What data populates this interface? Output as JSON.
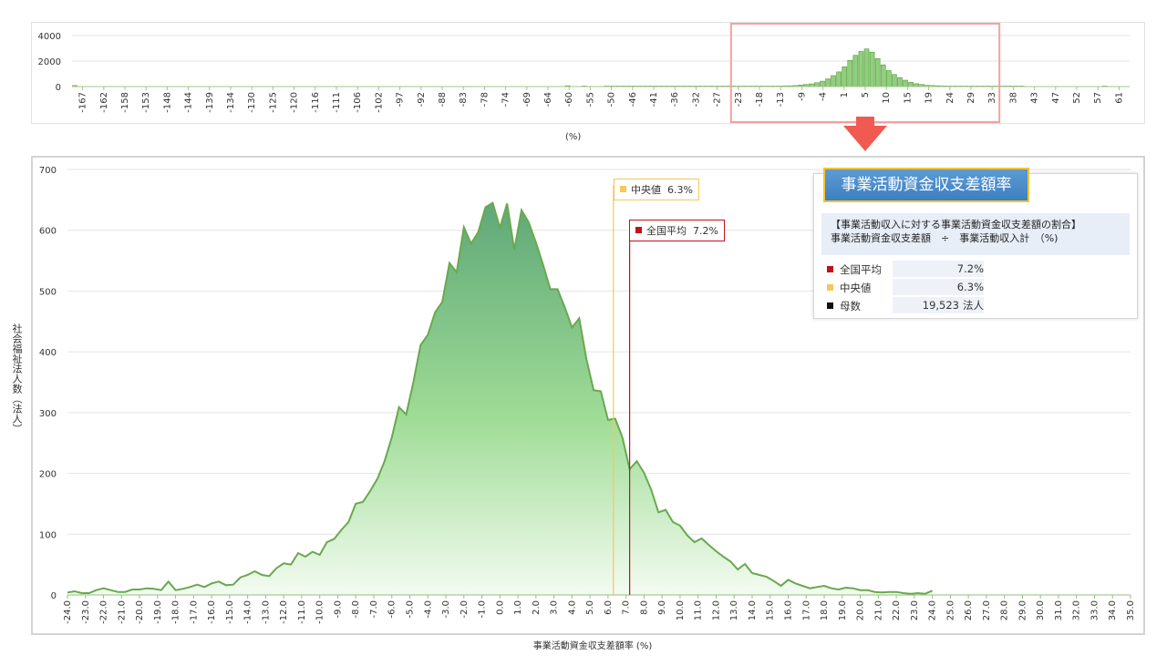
{
  "colors": {
    "accent_green": "#70ad47",
    "mean_red": "#c0121a",
    "median_yellow": "#f4c85a",
    "title_blue": "#4a8cd0",
    "arrow": "#f05a50"
  },
  "chart_data": [
    {
      "type": "bar",
      "xlabel": "(%)",
      "ylim": [
        0,
        4000
      ],
      "y_ticks": [
        0,
        2000,
        4000
      ],
      "tick_labels": [
        "-167",
        "-162",
        "-158",
        "-153",
        "-148",
        "-144",
        "-139",
        "-134",
        "-130",
        "-125",
        "-120",
        "-116",
        "-111",
        "-106",
        "-102",
        "-97",
        "-92",
        "-88",
        "-83",
        "-78",
        "-74",
        "-69",
        "-64",
        "-60",
        "-55",
        "-50",
        "-46",
        "-41",
        "-36",
        "-32",
        "-27",
        "-23",
        "-18",
        "-13",
        "-9",
        "-4",
        "1",
        "5",
        "10",
        "15",
        "19",
        "24",
        "29",
        "33",
        "38",
        "43",
        "47",
        "52",
        "57",
        "61"
      ],
      "values": [
        80,
        0,
        0,
        0,
        0,
        0,
        0,
        0,
        0,
        0,
        0,
        0,
        0,
        0,
        0,
        0,
        0,
        0,
        0,
        0,
        0,
        0,
        0,
        0,
        0,
        0,
        0,
        0,
        0,
        0,
        0,
        0,
        0,
        0,
        0,
        0,
        0,
        0,
        0,
        0,
        0,
        0,
        0,
        0,
        0,
        0,
        0,
        0,
        0,
        0,
        0,
        0,
        0,
        0,
        0,
        0,
        0,
        0,
        0,
        0,
        0,
        0,
        0,
        0,
        0,
        0,
        0,
        0,
        0,
        0,
        0,
        0,
        0,
        0,
        0,
        0,
        0,
        0,
        0,
        0,
        0,
        0,
        0,
        0,
        0,
        0,
        0,
        0,
        0,
        60,
        0,
        0,
        40,
        0,
        0,
        0,
        40,
        40,
        40,
        40,
        40,
        40,
        40,
        40,
        40,
        40,
        40,
        40,
        40,
        40,
        40,
        40,
        40,
        40,
        40,
        40,
        40,
        40,
        40,
        40,
        40,
        40,
        40,
        40,
        40,
        40,
        40,
        40,
        50,
        60,
        80,
        120,
        160,
        210,
        300,
        420,
        600,
        860,
        1150,
        1550,
        2050,
        2450,
        2750,
        2950,
        2700,
        2200,
        1700,
        1250,
        950,
        700,
        500,
        330,
        220,
        160,
        100,
        80,
        60,
        50,
        40,
        40,
        40,
        40,
        40,
        40,
        40,
        40,
        40,
        40,
        40,
        40,
        40,
        40,
        0,
        0,
        0,
        0,
        0,
        0,
        0,
        0,
        0,
        0,
        0,
        0,
        0,
        0,
        40,
        0,
        0,
        0,
        0
      ],
      "highlight_range": [
        "-23",
        "33"
      ]
    },
    {
      "type": "area",
      "title": "",
      "xlabel": "事業活動資金収支差額率 (%)",
      "ylabel": "社会福祉法人数（法人）",
      "xlim": [
        -24.0,
        35.0
      ],
      "ylim": [
        0,
        700
      ],
      "y_ticks": [
        0,
        100,
        200,
        300,
        400,
        500,
        600,
        700
      ],
      "x_ticks": [
        "-24.0",
        "-23.0",
        "-22.0",
        "-21.0",
        "-20.0",
        "-19.0",
        "-18.0",
        "-17.0",
        "-16.0",
        "-15.0",
        "-14.0",
        "-13.0",
        "-12.0",
        "-11.0",
        "-10.0",
        "-9.0",
        "-8.0",
        "-7.0",
        "-6.0",
        "-5.0",
        "-4.0",
        "-3.0",
        "-2.0",
        "-1.0",
        "0.0",
        "1.0",
        "2.0",
        "3.0",
        "4.0",
        "5.0",
        "6.0",
        "7.0",
        "8.0",
        "9.0",
        "10.0",
        "11.0",
        "12.0",
        "13.0",
        "14.0",
        "15.0",
        "16.0",
        "17.0",
        "18.0",
        "19.0",
        "20.0",
        "21.0",
        "22.0",
        "23.0",
        "24.0",
        "25.0",
        "26.0",
        "27.0",
        "28.0",
        "29.0",
        "30.0",
        "31.0",
        "32.0",
        "33.0",
        "34.0",
        "35.0"
      ],
      "x_step": 0.4,
      "values": [
        4,
        6,
        3,
        3,
        8,
        11,
        8,
        5,
        5,
        9,
        9,
        11,
        10,
        8,
        22,
        8,
        10,
        13,
        17,
        13,
        19,
        22,
        16,
        17,
        29,
        33,
        39,
        33,
        31,
        44,
        52,
        50,
        69,
        63,
        71,
        66,
        87,
        92,
        107,
        120,
        150,
        153,
        171,
        191,
        220,
        259,
        309,
        297,
        350,
        411,
        428,
        465,
        482,
        546,
        531,
        605,
        578,
        597,
        638,
        645,
        604,
        644,
        568,
        633,
        613,
        580,
        543,
        503,
        503,
        473,
        440,
        455,
        388,
        337,
        335,
        288,
        290,
        259,
        207,
        220,
        201,
        173,
        136,
        140,
        120,
        114,
        98,
        87,
        93,
        82,
        72,
        63,
        55,
        42,
        51,
        36,
        33,
        30,
        23,
        15,
        25,
        19,
        15,
        11,
        13,
        15,
        11,
        9,
        12,
        11,
        8,
        8,
        5,
        4,
        5,
        5,
        3,
        2,
        3,
        2,
        7
      ],
      "reference_lines": [
        {
          "name": "中央値",
          "value": 6.3
        },
        {
          "name": "全国平均",
          "value": 7.2
        }
      ]
    }
  ],
  "median_tag": {
    "label": "中央値",
    "value": "6.3%"
  },
  "mean_tag": {
    "label": "全国平均",
    "value": "7.2%"
  },
  "info": {
    "title": "事業活動資金収支差額率",
    "formula_line1": "【事業活動収入に対する事業活動資金収支差額の割合】",
    "formula_line2": "事業活動資金収支差額　÷　事業活動収入計　（%)",
    "rows": [
      {
        "label": "全国平均",
        "value": "7.2%",
        "unit": ""
      },
      {
        "label": "中央値",
        "value": "6.3%",
        "unit": ""
      },
      {
        "label": "母数",
        "value": "19,523",
        "unit": "法人"
      }
    ]
  }
}
